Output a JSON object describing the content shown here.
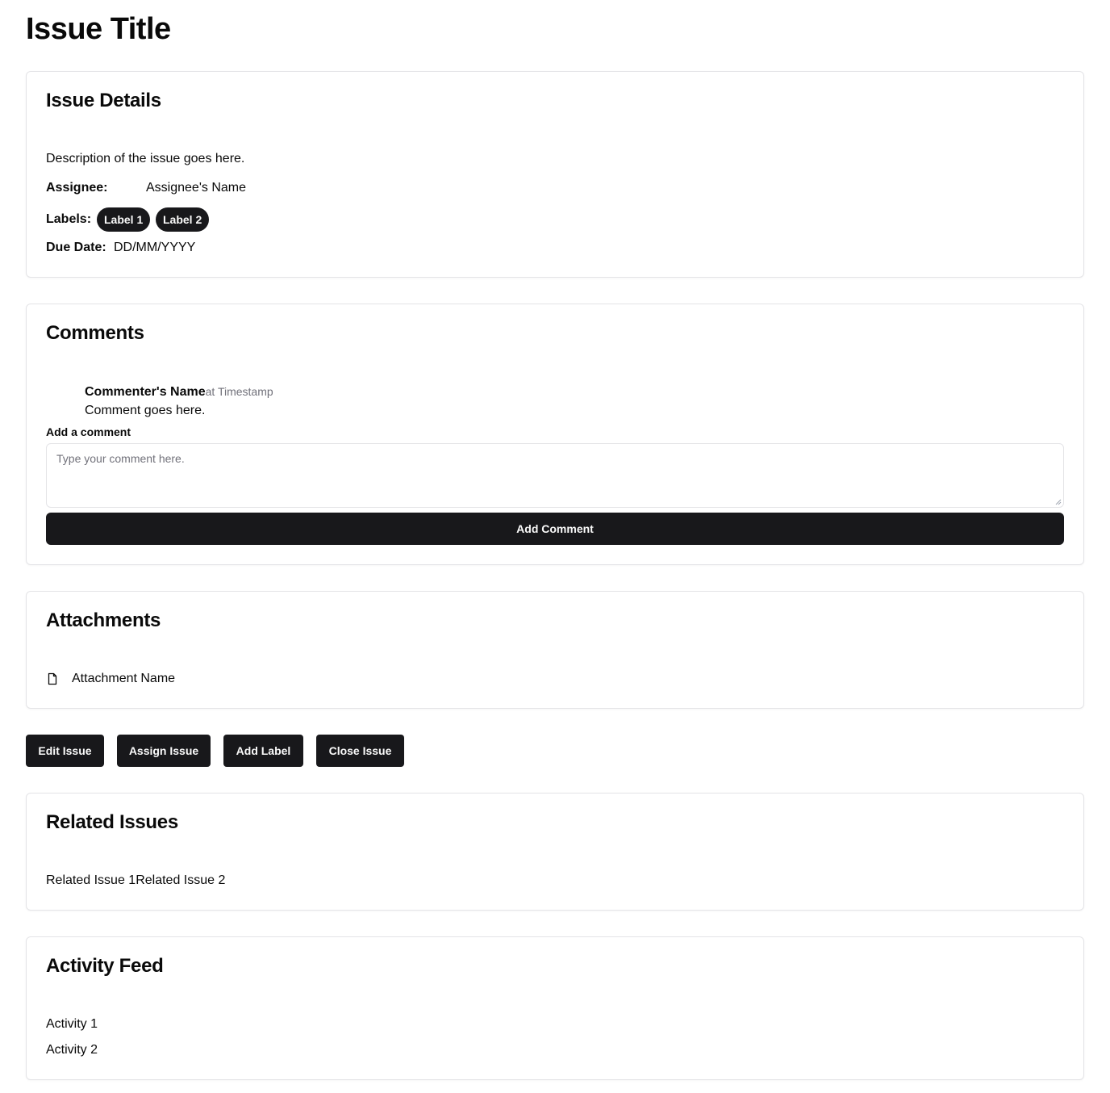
{
  "page": {
    "title": "Issue Title"
  },
  "details": {
    "title": "Issue Details",
    "description": "Description of the issue goes here.",
    "assignee_label": "Assignee:",
    "assignee_value": "Assignee's Name",
    "labels_label": "Labels:",
    "labels": [
      "Label 1",
      "Label 2"
    ],
    "due_label": "Due Date:",
    "due_value": "DD/MM/YYYY"
  },
  "comments": {
    "title": "Comments",
    "author": "Commenter's Name",
    "timestamp": "at Timestamp",
    "text": "Comment goes here.",
    "add_label": "Add a comment",
    "placeholder": "Type your comment here.",
    "submit": "Add Comment"
  },
  "attachments": {
    "title": "Attachments",
    "items": [
      "Attachment Name"
    ]
  },
  "actions": {
    "edit": "Edit Issue",
    "assign": "Assign Issue",
    "add_label": "Add Label",
    "close": "Close Issue"
  },
  "related": {
    "title": "Related Issues",
    "items": [
      "Related Issue 1",
      "Related Issue 2"
    ]
  },
  "activity": {
    "title": "Activity Feed",
    "items": [
      "Activity 1",
      "Activity 2"
    ]
  },
  "colors": {
    "primary": "#18181b",
    "border": "#e4e4e7",
    "muted": "#71717a"
  },
  "icons": {
    "attachment": "file-icon"
  }
}
